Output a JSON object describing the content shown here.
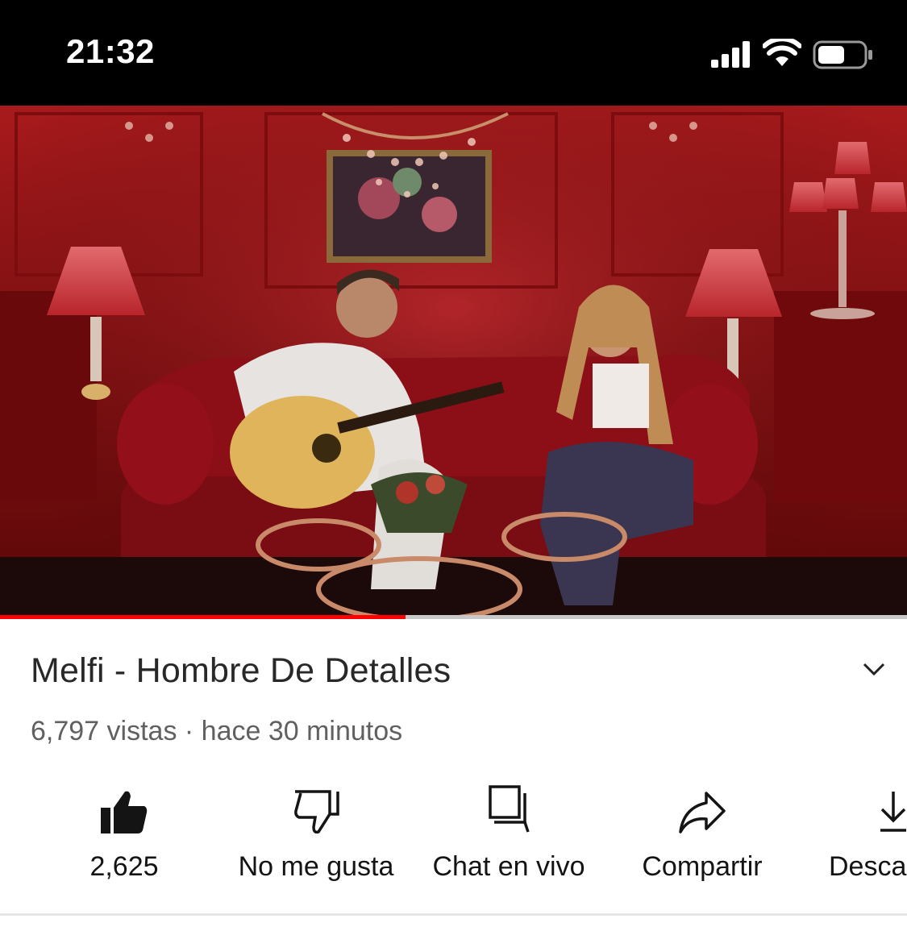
{
  "status_bar": {
    "time": "21:32",
    "icons": [
      "cellular-signal-icon",
      "wifi-icon",
      "battery-icon"
    ]
  },
  "video": {
    "progress_fraction": 0.447,
    "progress_color": "#ff0000"
  },
  "video_info": {
    "title": "Melfi - Hombre De Detalles",
    "meta": "6,797 vistas · hace 30 minutos",
    "expand_icon": "chevron-down-icon"
  },
  "actions": [
    {
      "icon": "thumbs-up-filled-icon",
      "label": "2,625"
    },
    {
      "icon": "thumbs-down-icon",
      "label": "No me gusta"
    },
    {
      "icon": "live-chat-icon",
      "label": "Chat en vivo"
    },
    {
      "icon": "share-icon",
      "label": "Compartir"
    },
    {
      "icon": "download-icon",
      "label": "Desca"
    }
  ]
}
